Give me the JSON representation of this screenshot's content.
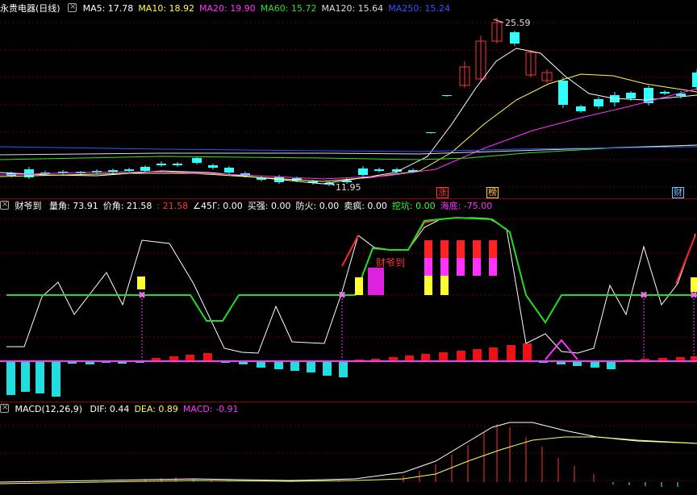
{
  "panel1": {
    "title": "永贵电器(日线)",
    "ma": [
      {
        "label": "MA5: 17.78",
        "color": "#ffffff"
      },
      {
        "label": "MA10: 18.92",
        "color": "#ffff55"
      },
      {
        "label": "MA20: 19.90",
        "color": "#ff33ff"
      },
      {
        "label": "MA60: 15.72",
        "color": "#33dd33"
      },
      {
        "label": "MA120: 15.64",
        "color": "#dddddd"
      },
      {
        "label": "MA250: 15.24",
        "color": "#3355ff"
      }
    ],
    "high_label": "25.59",
    "low_label": "11.95",
    "badges": [
      {
        "text": "涨",
        "color": "#ff3333"
      },
      {
        "text": "榜",
        "color": "#ffcc33"
      },
      {
        "text": "财",
        "color": "#66ccff"
      }
    ]
  },
  "panel2": {
    "title": "财爷到",
    "items": [
      {
        "label": "量角: 73.91",
        "color": "#ffffff"
      },
      {
        "label": "价角: 21.58",
        "color": "#ffffff"
      },
      {
        "label": ": 21.58",
        "color": "#ff3333"
      },
      {
        "label": "∠45Γ: 0.00",
        "color": "#ffffff"
      },
      {
        "label": "买强: 0.00",
        "color": "#ffffff"
      },
      {
        "label": "防火: 0.00",
        "color": "#ffffff"
      },
      {
        "label": "卖疯: 0.00",
        "color": "#ffffff"
      },
      {
        "label": "挖坑: 0.00",
        "color": "#33ff33"
      },
      {
        "label": "海底: -75.00",
        "color": "#ff33ff"
      }
    ],
    "annotation": "财爷到"
  },
  "panel3": {
    "title": "MACD(12,26,9)",
    "items": [
      {
        "label": "DIF: 0.44",
        "color": "#ffffff"
      },
      {
        "label": "DEA: 0.89",
        "color": "#ffff55"
      },
      {
        "label": "MACD: -0.91",
        "color": "#ff33ff"
      }
    ]
  },
  "colors": {
    "up": "#ff3333",
    "down": "#33ffff",
    "bg": "#000000",
    "grid": "#8b0000"
  }
}
